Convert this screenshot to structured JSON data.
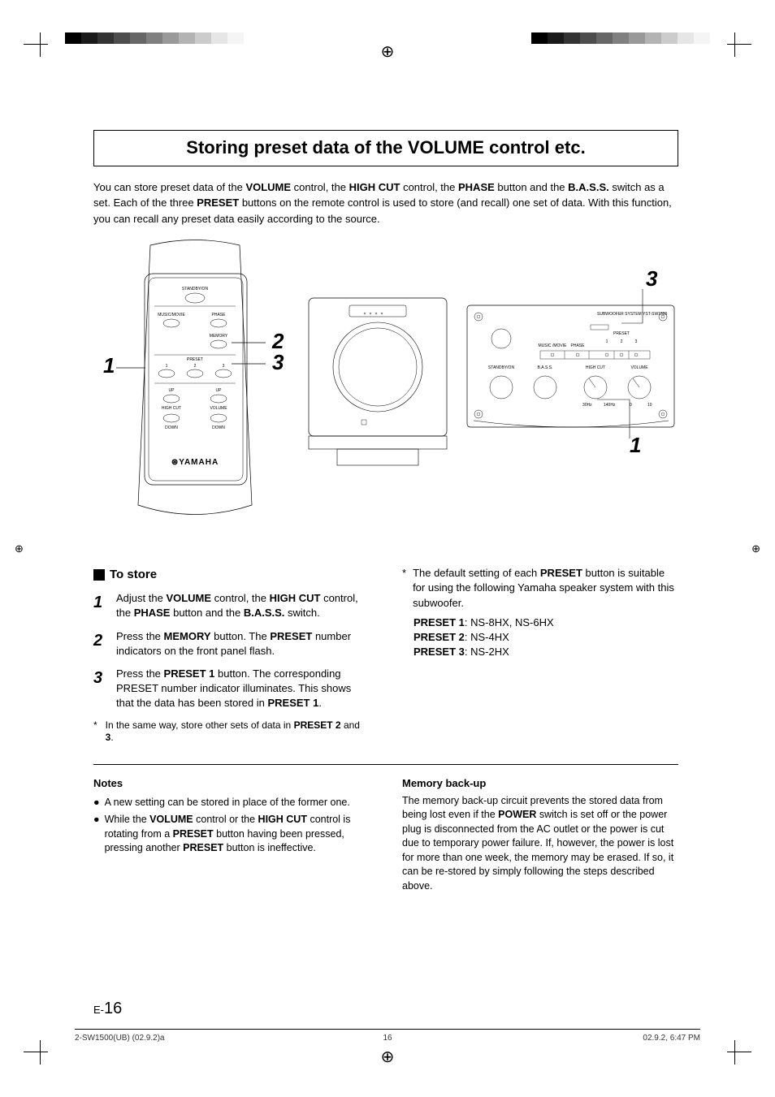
{
  "title": "Storing preset data of the VOLUME control etc.",
  "intro": {
    "p1a": "You can store preset data of the ",
    "p1b": " control, the ",
    "p1c": " control, the ",
    "p1d": " button and the ",
    "p1e": " switch as a set. Each of the three ",
    "p1f": " buttons on the remote control is used to store (and recall) one set of data. With this function, you can recall any preset data easily according to the source.",
    "VOLUME": "VOLUME",
    "HIGHCUT": "HIGH CUT",
    "PHASE": "PHASE",
    "BASS": "B.A.S.S.",
    "PRESET": "PRESET"
  },
  "callouts": {
    "one": "1",
    "two": "2",
    "three": "3",
    "three_panel": "3",
    "one_panel": "1"
  },
  "remote": {
    "standby": "STANDBY/ON",
    "music_movie": "MUSIC/MOVIE",
    "phase": "PHASE",
    "memory": "MEMORY",
    "preset": "PRESET",
    "p1": "1",
    "p2": "2",
    "p3": "3",
    "up": "UP",
    "highcut": "HIGH CUT",
    "volume": "VOLUME",
    "down": "DOWN",
    "brand": "YAMAHA"
  },
  "panel": {
    "title": "SUBWOOFER SYSTEM YST-SW1500",
    "music_movie": "MUSIC /MOVIE",
    "phase": "PHASE",
    "preset": "PRESET",
    "p1": "1",
    "p2": "2",
    "p3": "3",
    "standby": "STANDBY/ON",
    "bass": "B.A.S.S.",
    "highcut": "HIGH CUT",
    "volume": "VOLUME",
    "hc_lo": "30Hz",
    "hc_hi": "140Hz",
    "v_lo": "0",
    "v_hi": "10"
  },
  "to_store": {
    "heading": "To store",
    "step1": {
      "a": "Adjust the ",
      "b": " control, the ",
      "c": " control, the ",
      "d": " button and the ",
      "e": " switch."
    },
    "step2": {
      "a": "Press the ",
      "b": " button. The ",
      "c": " number indicators on the front panel flash."
    },
    "step3": {
      "a": "Press the ",
      "b": " button. The corresponding PRESET number indicator illuminates. This shows that the data has been stored in ",
      "c": "."
    },
    "footnote": {
      "a": "In the same way, store other sets of data in ",
      "b": " and ",
      "c": "."
    },
    "MEMORY": "MEMORY",
    "PRESET1": "PRESET 1",
    "PRESET2": "PRESET 2",
    "THREE": "3"
  },
  "right_col": {
    "note_a": "The default setting of each ",
    "note_b": " button is suitable for using the following Yamaha speaker system with this subwoofer.",
    "p1_label": "PRESET 1",
    "p1_val": ": NS-8HX, NS-6HX",
    "p2_label": "PRESET 2",
    "p2_val": ": NS-4HX",
    "p3_label": "PRESET 3",
    "p3_val": ": NS-2HX"
  },
  "notes": {
    "head": "Notes",
    "n1": "A new setting can be stored in place of the former one.",
    "n2a": "While the ",
    "n2b": " control or the ",
    "n2c": " control is rotating from a ",
    "n2d": " button having been pressed, pressing another ",
    "n2e": " button is ineffective."
  },
  "memory": {
    "head": "Memory back-up",
    "text_a": "The memory back-up circuit prevents the stored data from being lost even if the ",
    "text_b": " switch is set off or the power plug is disconnected from the AC outlet or the power is cut due to temporary power failure. If, however, the power is lost for more than one week, the memory may be erased. If so, it can be re-stored by simply following the steps described above.",
    "POWER": "POWER"
  },
  "page_num_prefix": "E-",
  "page_num": "16",
  "footer": {
    "left": "2-SW1500(UB)   (02.9.2)a",
    "center": "16",
    "right": "02.9.2, 6:47 PM"
  }
}
